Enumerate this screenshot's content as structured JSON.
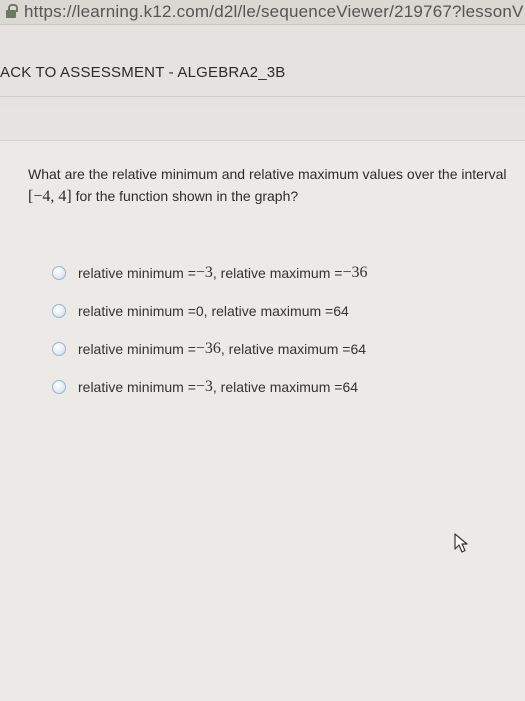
{
  "browser": {
    "url": "https://learning.k12.com/d2l/le/sequenceViewer/219767?lessonV"
  },
  "header": {
    "back_link": "ACK TO ASSESSMENT - ALGEBRA2_3B"
  },
  "question": {
    "text_before": "What are the relative minimum and relative maximum values over the interval ",
    "interval": "[−4, 4]",
    "text_after": " for the function shown in the graph?"
  },
  "options": [
    {
      "label_min": "relative minimum = ",
      "min": "−3",
      "label_max": ", relative maximum = ",
      "max": "−36"
    },
    {
      "label_min": "relative minimum = ",
      "min": "0",
      "label_max": ", relative maximum = ",
      "max": "64"
    },
    {
      "label_min": "relative minimum = ",
      "min": "−36",
      "label_max": ", relative maximum = ",
      "max": "64"
    },
    {
      "label_min": "relative minimum = ",
      "min": "−3",
      "label_max": ", relative maximum = ",
      "max": "64"
    }
  ]
}
